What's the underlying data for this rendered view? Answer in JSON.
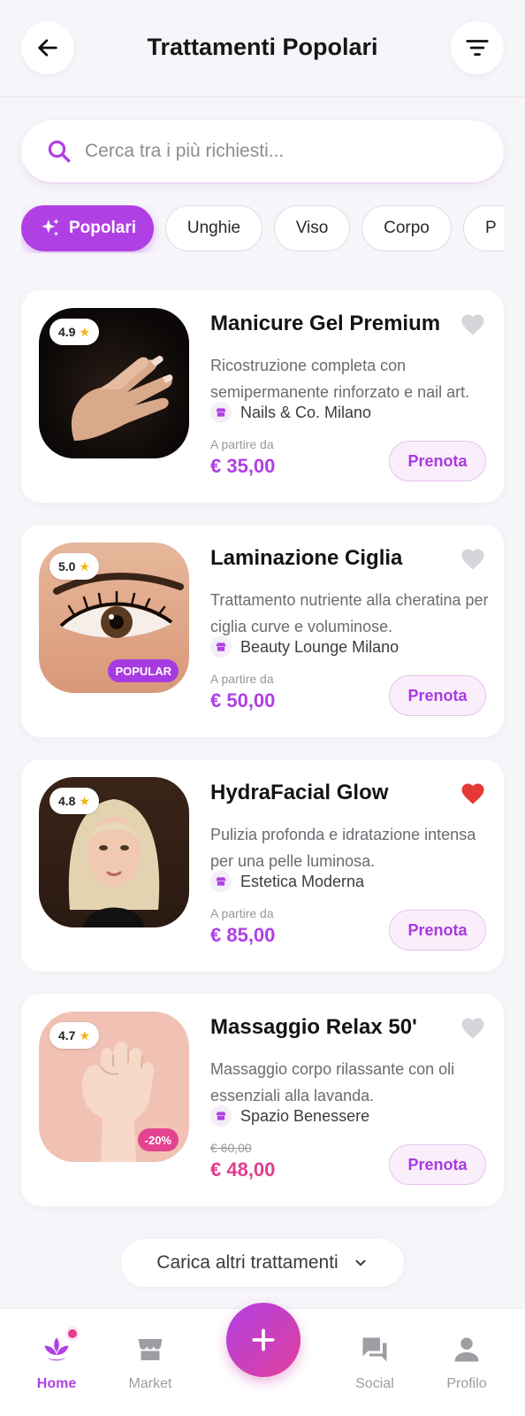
{
  "header": {
    "title": "Trattamenti Popolari",
    "back_icon": "arrow-left-icon",
    "filter_icon": "filter-lines-icon"
  },
  "search": {
    "placeholder": "Cerca tra i più richiesti...",
    "value": ""
  },
  "chips": [
    {
      "label": "Popolari",
      "active": true,
      "icon": "sparkles-icon"
    },
    {
      "label": "Unghie",
      "active": false
    },
    {
      "label": "Viso",
      "active": false
    },
    {
      "label": "Corpo",
      "active": false
    },
    {
      "label": "P",
      "active": false
    }
  ],
  "treatments": [
    {
      "title": "Manicure Gel Premium",
      "rating": "4.9",
      "description": "Ricostruzione completa con semipermanente rinforzato e nail art.",
      "shop": "Nails & Co. Milano",
      "price_prefix": "A partire da",
      "price": "€ 35,00",
      "favorite": false,
      "button": "Prenota"
    },
    {
      "title": "Laminazione Ciglia",
      "rating": "5.0",
      "tag": "POPULAR",
      "description": "Trattamento nutriente alla cheratina per ciglia curve e voluminose.",
      "shop": "Beauty Lounge Milano",
      "price_prefix": "A partire da",
      "price": "€ 50,00",
      "favorite": false,
      "button": "Prenota"
    },
    {
      "title": "HydraFacial Glow",
      "rating": "4.8",
      "description": "Pulizia profonda e idratazione intensa per una pelle luminosa.",
      "shop": "Estetica Moderna",
      "price_prefix": "A partire da",
      "price": "€ 85,00",
      "favorite": true,
      "button": "Prenota"
    },
    {
      "title": "Massaggio Relax 50'",
      "rating": "4.7",
      "tag": "-20%",
      "description": "Massaggio corpo rilassante con oli essenziali alla lavanda.",
      "shop": "Spazio Benessere",
      "old_price": "€ 60,00",
      "price": "€ 48,00",
      "favorite": false,
      "button": "Prenota"
    }
  ],
  "load_more": "Carica altri trattamenti",
  "nav": [
    {
      "label": "Home",
      "icon": "lotus-icon",
      "active": true
    },
    {
      "label": "Market",
      "icon": "store-icon",
      "active": false
    },
    {
      "label": "Social",
      "icon": "chat-bubbles-icon",
      "active": false
    },
    {
      "label": "Profilo",
      "icon": "person-icon",
      "active": false
    }
  ],
  "fab_icon": "plus-icon",
  "colors": {
    "accent": "#b040e4",
    "sale": "#e23d8c",
    "favorite": "#e53935",
    "background": "#f6f5f9"
  }
}
